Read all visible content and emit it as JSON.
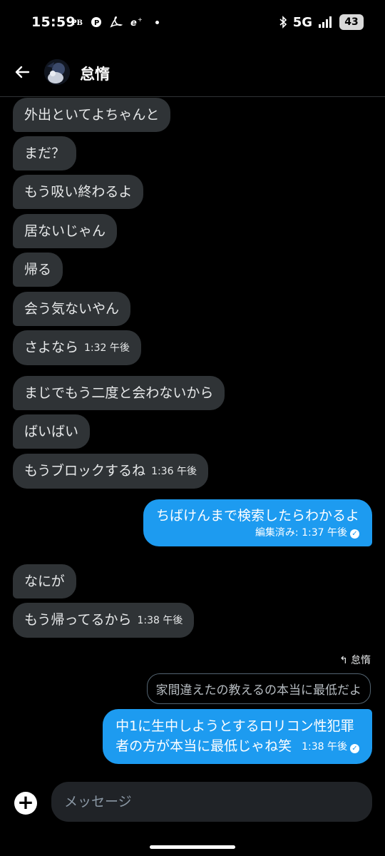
{
  "status_bar": {
    "time": "15:59",
    "icons_left": [
      "app-icon-pb",
      "app-icon-p",
      "adobe-icon",
      "app-icon-e"
    ],
    "network": "5G",
    "battery": "43",
    "icons_right": [
      "bluetooth-icon",
      "signal-icon",
      "battery-icon"
    ]
  },
  "header": {
    "name": "怠惰"
  },
  "messages": [
    {
      "text": "外出といてよちゃんと",
      "direction": "in"
    },
    {
      "text": "まだ？",
      "direction": "in"
    },
    {
      "text": "もう吸い終わるよ",
      "direction": "in"
    },
    {
      "text": "居ないじゃん",
      "direction": "in"
    },
    {
      "text": "帰る",
      "direction": "in"
    },
    {
      "text": "会う気ないやん",
      "direction": "in"
    },
    {
      "text": "さよなら",
      "time": "1:32 午後",
      "direction": "in"
    },
    {
      "text": "まじでもう二度と会わないから",
      "direction": "in"
    },
    {
      "text": "ばいばい",
      "direction": "in"
    },
    {
      "text": "もうブロックするね",
      "time": "1:36 午後",
      "direction": "in"
    },
    {
      "text": "ちばけんまで検索したらわかるよ",
      "meta": "編集済み: 1:37 午後",
      "direction": "out"
    },
    {
      "text": "なにが",
      "direction": "in"
    },
    {
      "text": "もう帰ってるから",
      "time": "1:38 午後",
      "direction": "in"
    },
    {
      "text_line1": "中1に生中しようとするロリコン性犯罪",
      "text_line2": "者の方が本当に最低じゃね笑",
      "time": "1:38 午後",
      "direction": "out"
    }
  ],
  "reply": {
    "label": "怠惰",
    "quoted_text": "家間違えたの教えるの本当に最低だよ"
  },
  "composer": {
    "placeholder": "メッセージ"
  },
  "colors": {
    "background": "#000000",
    "incoming_bubble": "#2f3336",
    "outgoing_bubble": "#1d9bf0"
  }
}
